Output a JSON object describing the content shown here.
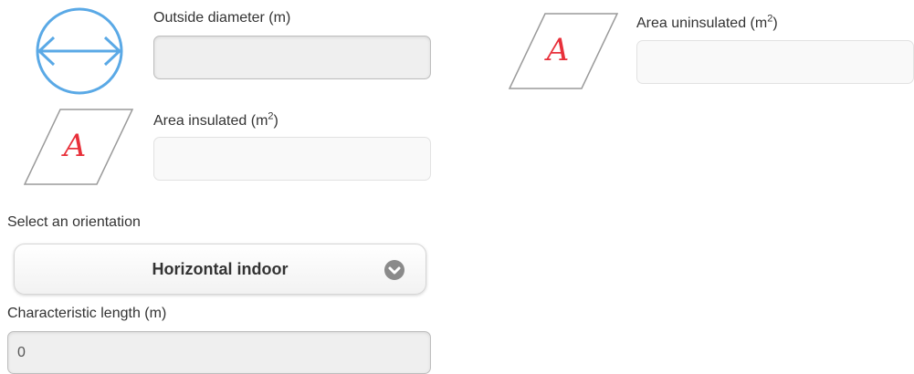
{
  "outside_diameter": {
    "label": "Outside diameter (m)",
    "icon": "diameter-circle-icon",
    "value": "",
    "color": "#5aa9e6"
  },
  "area_uninsulated": {
    "label_prefix": "Area uninsulated (m",
    "label_sup": "2",
    "label_suffix": ")",
    "icon": "area-parallelogram-icon",
    "icon_letter": "A",
    "value": ""
  },
  "area_insulated": {
    "label_prefix": "Area insulated (m",
    "label_sup": "2",
    "label_suffix": ")",
    "icon": "area-parallelogram-icon",
    "icon_letter": "A",
    "value": ""
  },
  "orientation": {
    "label": "Select an orientation",
    "selected": "Horizontal indoor",
    "icon": "chevron-down-icon"
  },
  "characteristic_length": {
    "label": "Characteristic length (m)",
    "value": "0"
  },
  "colors": {
    "diameter_icon": "#5aa9e6",
    "area_letter": "#e8303a",
    "area_outline": "#9a9a9a"
  }
}
